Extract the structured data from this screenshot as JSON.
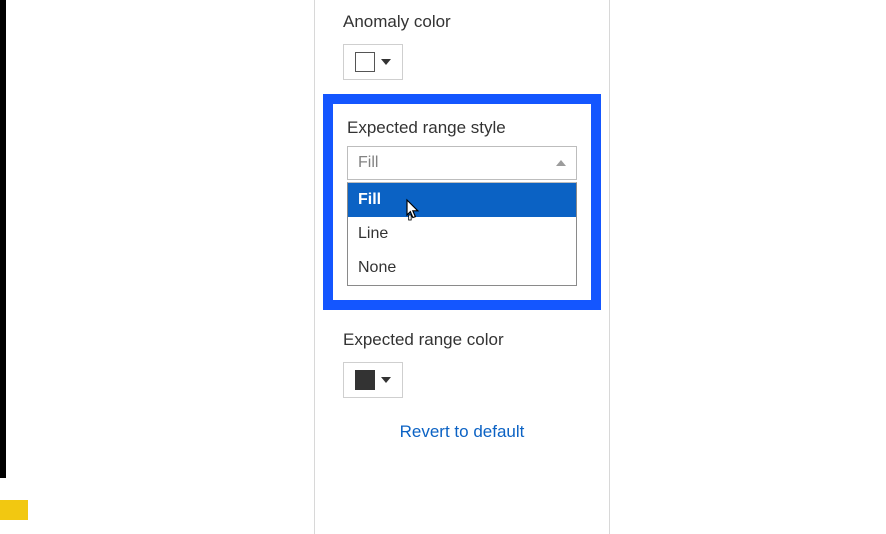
{
  "anomaly": {
    "label": "Anomaly color",
    "swatch_hex": "#ffffff"
  },
  "expected_style": {
    "label": "Expected range style",
    "selected": "Fill",
    "options": [
      "Fill",
      "Line",
      "None"
    ]
  },
  "expected_color": {
    "label": "Expected range color",
    "swatch_hex": "#333333"
  },
  "footer": {
    "revert": "Revert to default"
  }
}
